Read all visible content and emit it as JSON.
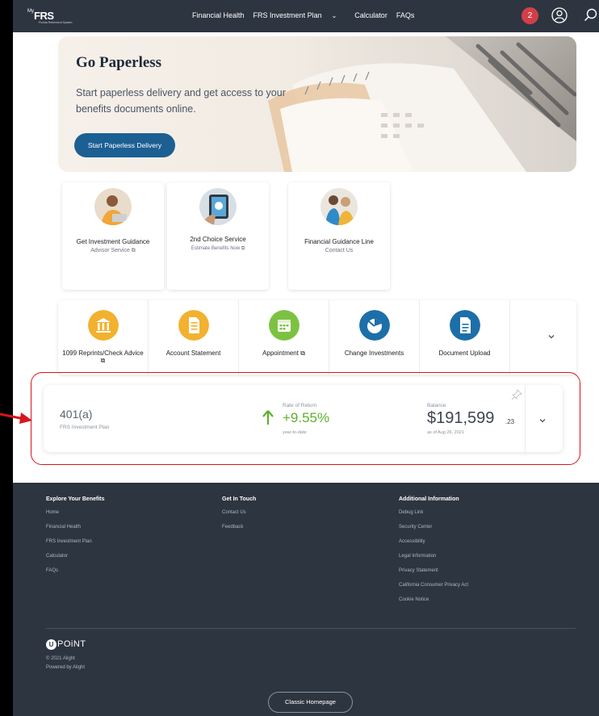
{
  "nav": {
    "logo_my": "My",
    "logo_frs": "FRS",
    "logo_tagline": "Florida Retirement System",
    "links": [
      "Financial Health",
      "FRS Investment Plan",
      "Calculator",
      "FAQs"
    ],
    "dropdown_caret": "⌄",
    "notification_count": "2",
    "icons": [
      "user-icon",
      "search-icon"
    ]
  },
  "hero": {
    "title": "Go Paperless",
    "body": "Start paperless delivery and get access to your benefits documents online.",
    "button_label": "Start Paperless Delivery"
  },
  "services": [
    {
      "title": "Get Investment Guidance",
      "subtitle": "Advisor Service ⧉"
    },
    {
      "title": "2nd Choice Service",
      "subtitle": "Estimate Benefits Now ⧉"
    },
    {
      "title": "Financial Guidance Line",
      "subtitle": "Contact Us"
    }
  ],
  "quick_actions": [
    {
      "label": "1099 Reprints/Check Advice ⧉",
      "icon": "bank-icon",
      "color": "#f2b12e"
    },
    {
      "label": "Account Statement",
      "icon": "statement-icon",
      "color": "#f2b12e"
    },
    {
      "label": "Appointment ⧉",
      "icon": "calendar-icon",
      "color": "#7cc242"
    },
    {
      "label": "Change Investments",
      "icon": "investment-icon",
      "color": "#1c6fa8"
    },
    {
      "label": "Document Upload",
      "icon": "document-icon",
      "color": "#1c6fa8"
    }
  ],
  "account": {
    "name": "401(a)",
    "plan": "FRS Investment Plan",
    "return_label": "Rate of Return",
    "return_value": "+9.55%",
    "return_period": "year-to-date",
    "balance_label": "Balance",
    "balance_value": "$191,599",
    "balance_cents": ".23",
    "balance_date": "as of Aug 26, 2021"
  },
  "footer": {
    "explore": {
      "heading": "Explore Your Benefits",
      "links": [
        "Home",
        "Financial Health",
        "FRS Investment Plan",
        "Calculator",
        "FAQs"
      ]
    },
    "touch": {
      "heading": "Get In Touch",
      "links": [
        "Contact Us",
        "Feedback"
      ]
    },
    "additional": {
      "heading": "Additional Information",
      "links": [
        "Debug Link",
        "Security Center",
        "Accessibility",
        "Legal Information",
        "Privacy Statement",
        "California Consumer Privacy Act",
        "Cookie Notice"
      ]
    },
    "brand": "POiNT",
    "brand_u": "U",
    "copyright": "© 2021 Alight",
    "powered": "Powered by Alight",
    "classic_button": "Classic Homepage"
  },
  "colors": {
    "nav_bg": "#2d3540",
    "accent_blue": "#1c5f93",
    "badge_red": "#d33f49",
    "return_green": "#5cb02e",
    "highlight_red": "#d8141d"
  }
}
